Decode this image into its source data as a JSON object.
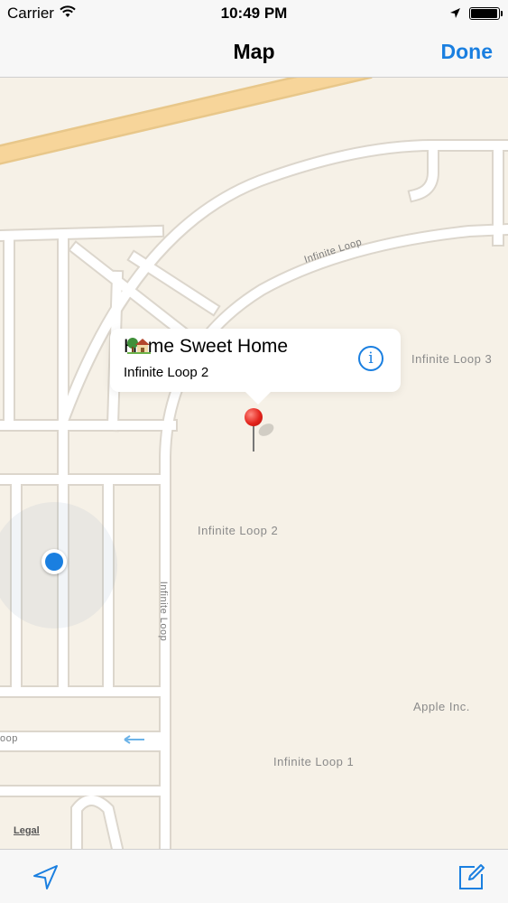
{
  "status_bar": {
    "carrier": "Carrier",
    "time": "10:49 PM",
    "icons": [
      "wifi-icon",
      "location-arrow-icon",
      "battery-icon"
    ]
  },
  "nav": {
    "title": "Map",
    "done_label": "Done"
  },
  "map": {
    "road_labels": [
      "Infinite Loop",
      "Infinite Loop",
      "oop"
    ],
    "place_labels": [
      "Infinite Loop 3",
      "Infinite Loop 2",
      "Apple Inc.",
      "Infinite Loop 1"
    ],
    "legal_label": "Legal"
  },
  "callout": {
    "title": "Home Sweet Home",
    "title_icon": "house-with-garden-icon",
    "subtitle": "Infinite Loop 2",
    "accessory_icon": "info-icon"
  },
  "toolbar": {
    "left_icon": "location-arrow-icon",
    "right_icon": "compose-icon"
  },
  "colors": {
    "accent": "#1a7fe0",
    "map_background": "#f6f1e7",
    "highway": "#f7d59a",
    "pin": "#e3241c"
  }
}
